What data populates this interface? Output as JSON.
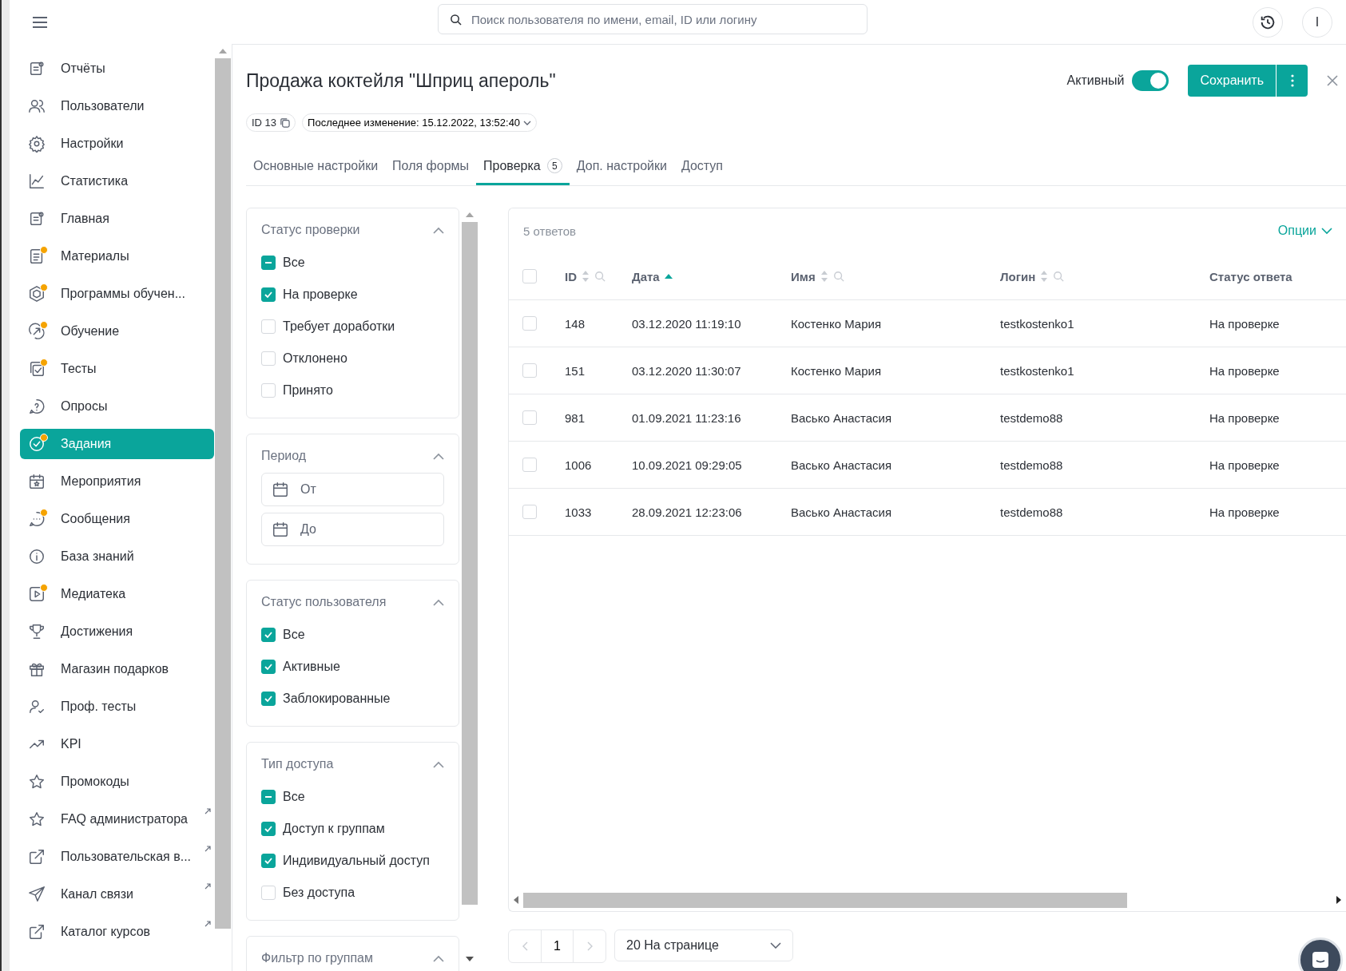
{
  "header": {
    "search": {
      "placeholder": "Поиск пользователя по имени, email, ID или логину"
    },
    "user_initial": "I"
  },
  "sidebar": {
    "items": [
      {
        "label": "Отчёты",
        "badge": false,
        "external": false,
        "selected": false
      },
      {
        "label": "Пользователи",
        "badge": false,
        "external": false,
        "selected": false
      },
      {
        "label": "Настройки",
        "badge": false,
        "external": false,
        "selected": false
      },
      {
        "label": "Статистика",
        "badge": false,
        "external": false,
        "selected": false
      },
      {
        "label": "Главная",
        "badge": false,
        "external": false,
        "selected": false
      },
      {
        "label": "Материалы",
        "badge": true,
        "external": false,
        "selected": false
      },
      {
        "label": "Программы обучен...",
        "badge": true,
        "external": false,
        "selected": false
      },
      {
        "label": "Обучение",
        "badge": true,
        "external": false,
        "selected": false
      },
      {
        "label": "Тесты",
        "badge": true,
        "external": false,
        "selected": false
      },
      {
        "label": "Опросы",
        "badge": false,
        "external": false,
        "selected": false
      },
      {
        "label": "Задания",
        "badge": true,
        "external": false,
        "selected": true
      },
      {
        "label": "Мероприятия",
        "badge": false,
        "external": false,
        "selected": false
      },
      {
        "label": "Сообщения",
        "badge": true,
        "external": false,
        "selected": false
      },
      {
        "label": "База знаний",
        "badge": false,
        "external": false,
        "selected": false
      },
      {
        "label": "Медиатека",
        "badge": true,
        "external": false,
        "selected": false
      },
      {
        "label": "Достижения",
        "badge": false,
        "external": false,
        "selected": false
      },
      {
        "label": "Магазин подарков",
        "badge": false,
        "external": false,
        "selected": false
      },
      {
        "label": "Проф. тесты",
        "badge": false,
        "external": false,
        "selected": false
      },
      {
        "label": "KPI",
        "badge": false,
        "external": false,
        "selected": false
      },
      {
        "label": "Промокоды",
        "badge": false,
        "external": false,
        "selected": false
      },
      {
        "label": "FAQ администратора",
        "badge": false,
        "external": true,
        "selected": false
      },
      {
        "label": "Пользовательская в...",
        "badge": false,
        "external": true,
        "selected": false
      },
      {
        "label": "Канал связи",
        "badge": false,
        "external": true,
        "selected": false
      },
      {
        "label": "Каталог курсов",
        "badge": false,
        "external": true,
        "selected": false
      }
    ]
  },
  "page": {
    "title": "Продажа коктейля \"Шприц апероль\"",
    "id_chip": "ID 13",
    "last_change": "Последнее изменение: 15.12.2022, 13:52:40",
    "active_label": "Активный",
    "active": true,
    "save_button": "Сохранить"
  },
  "tabs": [
    {
      "label": "Основные настройки",
      "selected": false
    },
    {
      "label": "Поля формы",
      "selected": false
    },
    {
      "label": "Проверка",
      "count": "5",
      "selected": true
    },
    {
      "label": "Доп. настройки",
      "selected": false
    },
    {
      "label": "Доступ",
      "selected": false
    }
  ],
  "filters": [
    {
      "kind": "checkboxes",
      "title": "Статус проверки",
      "expanded": true,
      "options": [
        {
          "label": "Все",
          "checked": false,
          "indeterminate": true
        },
        {
          "label": "На проверке",
          "checked": true,
          "indeterminate": false
        },
        {
          "label": "Требует доработки",
          "checked": false,
          "indeterminate": false
        },
        {
          "label": "Отклонено",
          "checked": false,
          "indeterminate": false
        },
        {
          "label": "Принято",
          "checked": false,
          "indeterminate": false
        }
      ]
    },
    {
      "kind": "dates",
      "title": "Период",
      "expanded": true,
      "fields": [
        {
          "placeholder": "От"
        },
        {
          "placeholder": "До"
        }
      ]
    },
    {
      "kind": "checkboxes",
      "title": "Статус пользователя",
      "expanded": true,
      "options": [
        {
          "label": "Все",
          "checked": true,
          "indeterminate": false
        },
        {
          "label": "Активные",
          "checked": true,
          "indeterminate": false
        },
        {
          "label": "Заблокированные",
          "checked": true,
          "indeterminate": false
        }
      ]
    },
    {
      "kind": "checkboxes",
      "title": "Тип доступа",
      "expanded": true,
      "options": [
        {
          "label": "Все",
          "checked": false,
          "indeterminate": true
        },
        {
          "label": "Доступ к группам",
          "checked": true,
          "indeterminate": false
        },
        {
          "label": "Индивидуальный доступ",
          "checked": true,
          "indeterminate": false
        },
        {
          "label": "Без доступа",
          "checked": false,
          "indeterminate": false
        }
      ]
    },
    {
      "kind": "checkboxes",
      "title": "Фильтр по группам",
      "expanded": true
    }
  ],
  "table": {
    "count": "5 ответов",
    "options": "Опции",
    "all_checked": false,
    "columns": [
      {
        "label": "ID",
        "sortable": true,
        "sorted": false,
        "searchable": true
      },
      {
        "label": "Дата",
        "sortable": true,
        "sorted": true,
        "searchable": false
      },
      {
        "label": "Имя",
        "sortable": true,
        "sorted": false,
        "searchable": true
      },
      {
        "label": "Логин",
        "sortable": true,
        "sorted": false,
        "searchable": true
      },
      {
        "label": "Статус ответа"
      }
    ],
    "rows": [
      {
        "checked": false,
        "cells": [
          "148",
          "03.12.2020 11:19:10",
          "Костенко Мария",
          "testkostenko1",
          "На проверке"
        ]
      },
      {
        "checked": false,
        "cells": [
          "151",
          "03.12.2020 11:30:07",
          "Костенко Мария",
          "testkostenko1",
          "На проверке"
        ]
      },
      {
        "checked": false,
        "cells": [
          "981",
          "01.09.2021 11:23:16",
          "Васько Анастасия",
          "testdemo88",
          "На проверке"
        ]
      },
      {
        "checked": false,
        "cells": [
          "1006",
          "10.09.2021 09:29:05",
          "Васько Анастасия",
          "testdemo88",
          "На проверке"
        ]
      },
      {
        "checked": false,
        "cells": [
          "1033",
          "28.09.2021 12:23:06",
          "Васько Анастасия",
          "testdemo88",
          "На проверке"
        ]
      }
    ]
  },
  "pagination": {
    "page": "1",
    "page_size": "20 На странице"
  }
}
